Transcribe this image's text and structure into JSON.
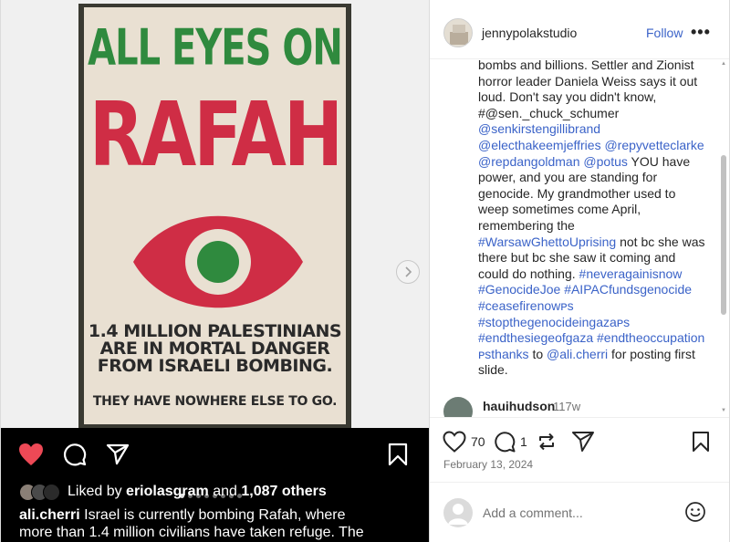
{
  "poster": {
    "line1": "ALL EYES ON",
    "line2": "RAFAH",
    "line3": [
      "1.4 MILLION PALESTINIANS",
      "ARE IN MORTAL DANGER",
      "FROM ISRAELI BOMBING."
    ],
    "line4": "THEY HAVE NOWHERE ELSE TO GO."
  },
  "media": {
    "next_icon": "chevron-right-icon",
    "liked_by_prefix": "Liked by",
    "liked_by_user": "eriolasgram",
    "liked_by_and": "and",
    "liked_by_others": "1,087 others",
    "caption_user": "ali.cherri",
    "caption_line1": "Israel is currently bombing Rafah, where",
    "caption_line2": "more than 1.4 million civilians have taken refuge. The",
    "carousel_count": 8,
    "carousel_active": 0
  },
  "header": {
    "username": "jennypolakstudio",
    "follow_label": "Follow",
    "more_label": "•••"
  },
  "caption": {
    "p1": "bombs and billions. Settler and Zionist horror leader Daniela Weiss says it out loud. Don't say you didn't know, #@sen._chuck_schumer",
    "l1": "@senkirstengillibrand",
    "l2": "@electhakeemjeffries",
    "l3": "@repyvetteclarke",
    "l4": "@repdangoldman",
    "l5": "@potus",
    "p2": "YOU have power, and you are standing for genocide. My grandmother used to weep sometimes come April, remembering the",
    "l6": "#WarsawGhettoUprising",
    "p3": "not bc she was there but bc she saw it coming and could do nothing.",
    "l7": "#neveragainisnow",
    "l8": "#GenocideJoe",
    "l9": "#AIPACfundsgenocide",
    "l10": "#ceasefirenowᴘs",
    "l11": "#stopthegenocideingazaᴘs",
    "l12": "#endthesiegeofgaza",
    "l13": "#endtheoccupation",
    "l14": "ᴘsthanks",
    "p4": "to",
    "l15": "@ali.cherri",
    "p5": "for posting first slide."
  },
  "comment": {
    "username": "hauihudson",
    "time": "117w"
  },
  "actions": {
    "likes_count": "70",
    "comments_count": "1",
    "date": "February 13, 2024"
  },
  "add_comment": {
    "placeholder": "Add a comment..."
  },
  "colors": {
    "accent_link": "#3b63c8",
    "like_red": "#ed4956",
    "poster_green": "#2f8a3e",
    "poster_red": "#cf2d45",
    "poster_paper": "#e9e0d2"
  }
}
